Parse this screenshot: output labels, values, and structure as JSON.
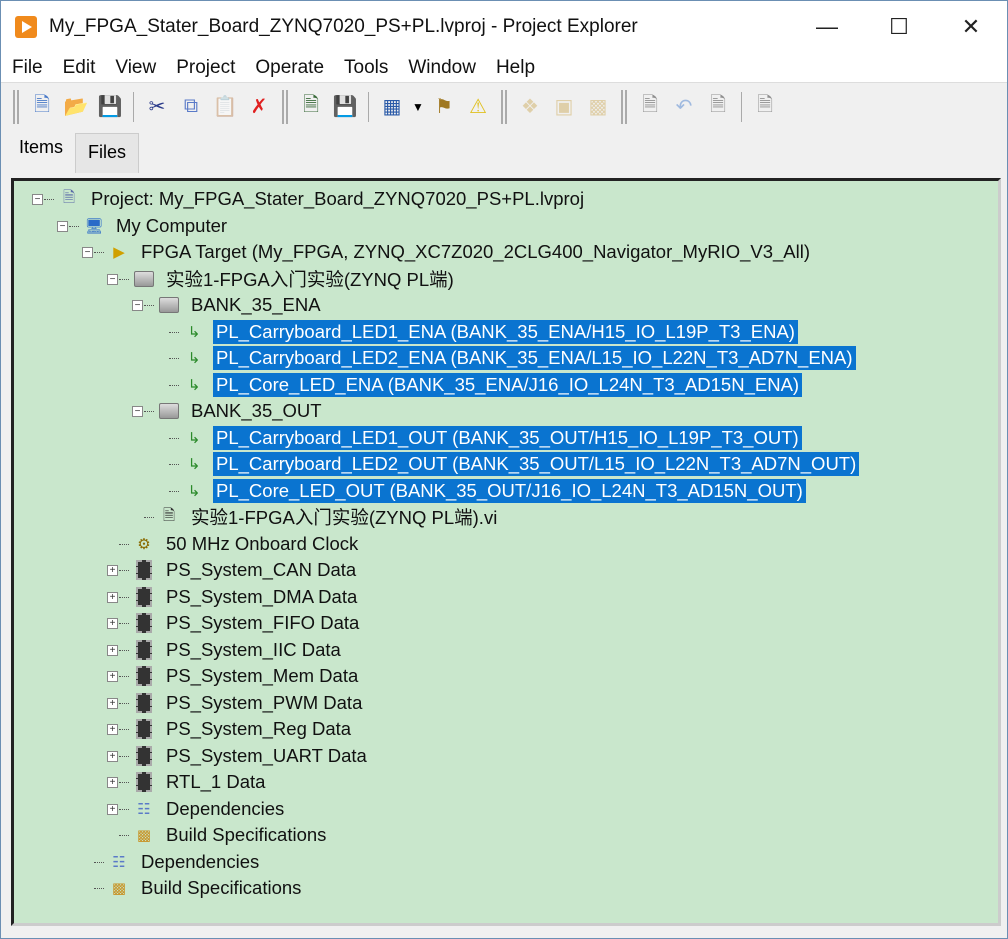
{
  "window": {
    "title": "My_FPGA_Stater_Board_ZYNQ7020_PS+PL.lvproj - Project Explorer"
  },
  "menu": [
    "File",
    "Edit",
    "View",
    "Project",
    "Operate",
    "Tools",
    "Window",
    "Help"
  ],
  "tabs": [
    "Items",
    "Files"
  ],
  "colors": {
    "tree_bg": "#c9e7cc",
    "selection": "#0a74d0"
  },
  "tree": [
    {
      "depth": 0,
      "exp": "-",
      "icon": "project-icon",
      "label": "Project: My_FPGA_Stater_Board_ZYNQ7020_PS+PL.lvproj"
    },
    {
      "depth": 1,
      "exp": "-",
      "icon": "computer-icon",
      "label": "My Computer"
    },
    {
      "depth": 2,
      "exp": "-",
      "icon": "fpga-target-icon",
      "label": "FPGA Target (My_FPGA, ZYNQ_XC7Z020_2CLG400_Navigator_MyRIO_V3_All)"
    },
    {
      "depth": 3,
      "exp": "-",
      "icon": "folder-icon",
      "label": "实验1-FPGA入门实验(ZYNQ PL端)"
    },
    {
      "depth": 4,
      "exp": "-",
      "icon": "folder-icon",
      "label": "BANK_35_ENA"
    },
    {
      "depth": 5,
      "exp": "",
      "icon": "io-pin-icon",
      "label": "PL_Carryboard_LED1_ENA (BANK_35_ENA/H15_IO_L19P_T3_ENA)",
      "selected": true
    },
    {
      "depth": 5,
      "exp": "",
      "icon": "io-pin-icon",
      "label": "PL_Carryboard_LED2_ENA (BANK_35_ENA/L15_IO_L22N_T3_AD7N_ENA)",
      "selected": true
    },
    {
      "depth": 5,
      "exp": "",
      "icon": "io-pin-icon",
      "label": "PL_Core_LED_ENA (BANK_35_ENA/J16_IO_L24N_T3_AD15N_ENA)",
      "selected": true
    },
    {
      "depth": 4,
      "exp": "-",
      "icon": "folder-icon",
      "label": "BANK_35_OUT"
    },
    {
      "depth": 5,
      "exp": "",
      "icon": "io-pin-icon",
      "label": "PL_Carryboard_LED1_OUT (BANK_35_OUT/H15_IO_L19P_T3_OUT)",
      "selected": true
    },
    {
      "depth": 5,
      "exp": "",
      "icon": "io-pin-icon",
      "label": "PL_Carryboard_LED2_OUT (BANK_35_OUT/L15_IO_L22N_T3_AD7N_OUT)",
      "selected": true
    },
    {
      "depth": 5,
      "exp": "",
      "icon": "io-pin-icon",
      "label": "PL_Core_LED_OUT (BANK_35_OUT/J16_IO_L24N_T3_AD15N_OUT)",
      "selected": true
    },
    {
      "depth": 4,
      "exp": "",
      "icon": "vi-icon",
      "label": "实验1-FPGA入门实验(ZYNQ PL端).vi"
    },
    {
      "depth": 3,
      "exp": "",
      "icon": "clock-icon",
      "label": "50 MHz Onboard Clock"
    },
    {
      "depth": 3,
      "exp": "+",
      "icon": "data-icon",
      "label": "PS_System_CAN Data"
    },
    {
      "depth": 3,
      "exp": "+",
      "icon": "data-icon",
      "label": "PS_System_DMA Data"
    },
    {
      "depth": 3,
      "exp": "+",
      "icon": "data-icon",
      "label": "PS_System_FIFO Data"
    },
    {
      "depth": 3,
      "exp": "+",
      "icon": "data-icon",
      "label": "PS_System_IIC Data"
    },
    {
      "depth": 3,
      "exp": "+",
      "icon": "data-icon",
      "label": "PS_System_Mem Data"
    },
    {
      "depth": 3,
      "exp": "+",
      "icon": "data-icon",
      "label": "PS_System_PWM Data"
    },
    {
      "depth": 3,
      "exp": "+",
      "icon": "data-icon",
      "label": "PS_System_Reg Data"
    },
    {
      "depth": 3,
      "exp": "+",
      "icon": "data-icon",
      "label": "PS_System_UART Data"
    },
    {
      "depth": 3,
      "exp": "+",
      "icon": "data-icon",
      "label": "RTL_1 Data"
    },
    {
      "depth": 3,
      "exp": "+",
      "icon": "dependencies-icon",
      "label": "Dependencies"
    },
    {
      "depth": 3,
      "exp": "",
      "icon": "build-specifications-icon",
      "label": "Build Specifications"
    },
    {
      "depth": 2,
      "exp": "",
      "icon": "dependencies-icon",
      "label": "Dependencies"
    },
    {
      "depth": 2,
      "exp": "",
      "icon": "build-specifications-icon",
      "label": "Build Specifications"
    }
  ]
}
